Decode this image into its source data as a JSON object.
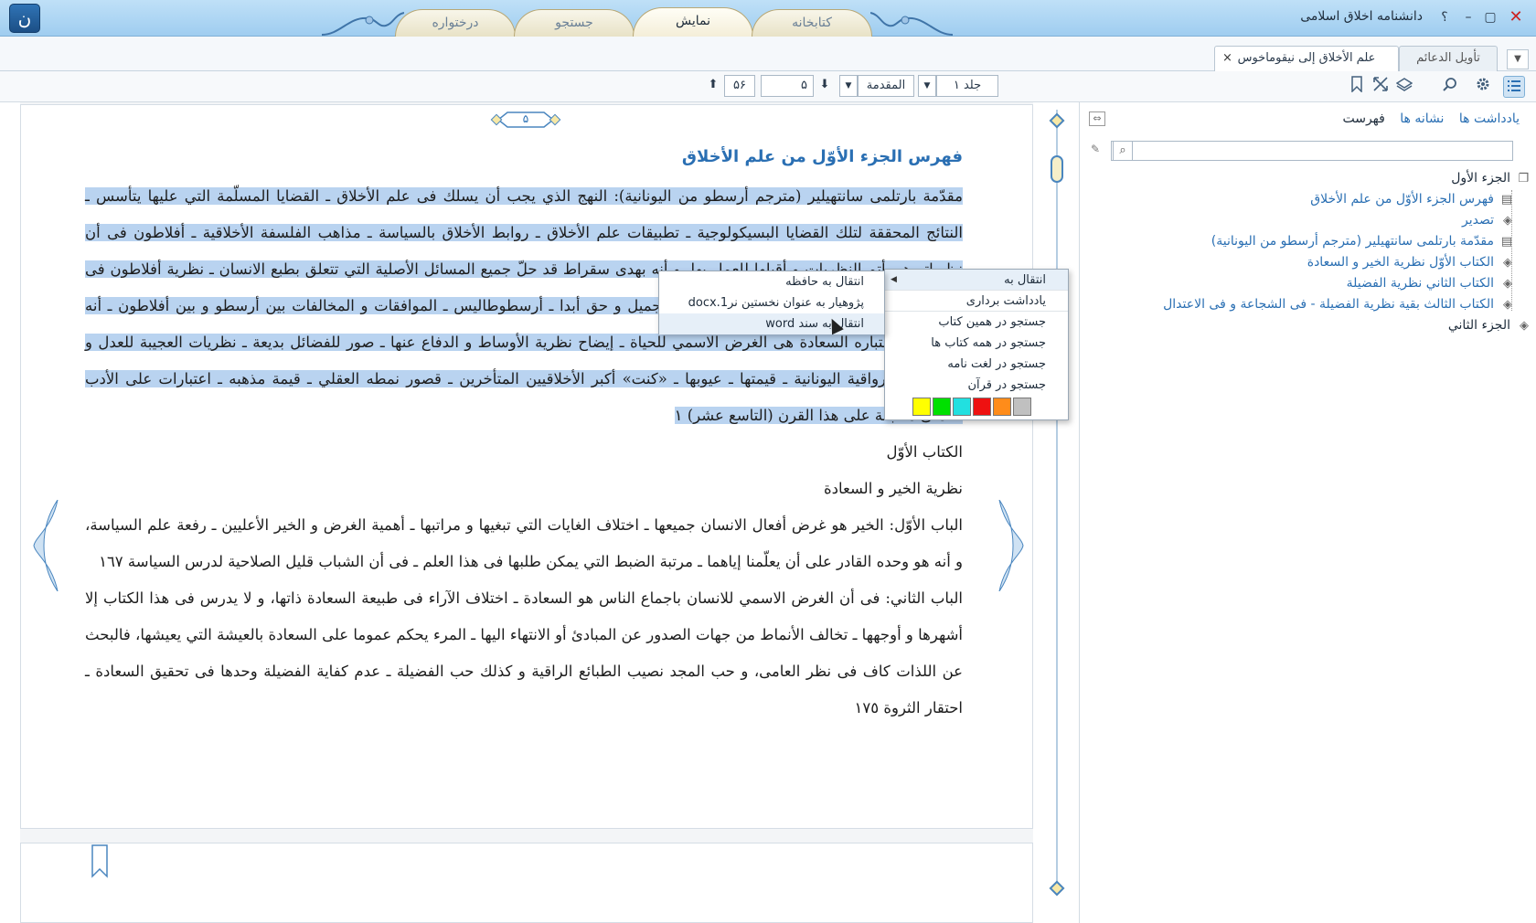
{
  "window": {
    "title": "دانشنامه اخلاق اسلامی",
    "help": "؟",
    "min": "–",
    "max": "▢",
    "close": "✕",
    "logo_glyph": "ن"
  },
  "main_tabs": [
    "کتابخانه",
    "نمایش",
    "جستجو",
    "درختواره"
  ],
  "book_tabs": {
    "tab1": "تأويل الدعائم",
    "tab2": "علم الأخلاق إلى نيقوماخوس",
    "close": "×",
    "dropdown": "▼"
  },
  "toolbar": {
    "volume": "جلد ١",
    "section": "المقدمة",
    "page": "۵",
    "total": "۵۶",
    "dropdown": "▼",
    "down": "⬇",
    "up": "⬆"
  },
  "side_panel": {
    "tabs": [
      "فهرست",
      "نشانه ها",
      "یادداشت ها"
    ],
    "tree": [
      {
        "label": "الجزء الأول",
        "level": 1,
        "icon": "book-icon"
      },
      {
        "label": "فهرس الجزء الأوّل من علم الأخلاق",
        "level": 2,
        "icon": "page-icon"
      },
      {
        "label": "تصدير",
        "level": 2,
        "icon": "layers-icon"
      },
      {
        "label": "مقدّمة بارتلمی سانتهيلير (مترجم أرسطو من اليونانية)",
        "level": 2,
        "icon": "page-icon"
      },
      {
        "label": "الكتاب الأوّل نظرية الخير و السعادة",
        "level": 2,
        "icon": "layers-icon"
      },
      {
        "label": "الكتاب الثاني نظرية الفضيلة",
        "level": 2,
        "icon": "layers-icon"
      },
      {
        "label": "الكتاب الثالث بقية نظرية الفضيلة - فی الشجاعة و فی الاعتدال",
        "level": 2,
        "icon": "layers-icon"
      },
      {
        "label": "الجزء الثاني",
        "level": 1,
        "icon": "layers-icon"
      }
    ]
  },
  "page": {
    "number": "۵",
    "heading": "فهرس الجزء الأوّل من علم الأخلاق",
    "selected_text": "مقدّمة بارتلمی سانتهيلير (مترجم أرسطو من اليونانية): النهج الذي يجب أن يسلك فی علم الأخلاق ـ القضايا المسلّمة التي عليها يتأسس ـ النتائج المحققة لتلك القضايا البسيكولوجية ـ تطبيقات علم الأخلاق ـ روابط الأخلاق بالسياسة ـ مذاهب الفلسفة الأخلاقية ـ أفلاطون فی أن نظرياته هی أتم النظريات و أقبلها للعمل بها، و أنه بهدى سقراط قد حلّ جميع المسائل الأصلية التي تتعلق بطبع الانسان ـ نظرية أفلاطون فی الخير معصومة من الخطأ ـ فی أن هذا المذهب جميل و حق أبدا ـ أرسطوطاليس ـ الموافقات و المخالفات بين أرسطو و بين أفلاطون ـ أنه انخدع فی اعتباره السعادة هی الغرض الاسمي للحياة ـ إيضاح نظرية الأوساط و الدفاع عنها ـ صور للفضائل بديعة ـ نظريات العجيبة للعدل و الصداقة ـ الرواقية اليونانية ـ قيمتها ـ عيوبها ـ «كنت» أكبر الأخلاقيين المتأخرين ـ قصور نمطه العقلي ـ قيمة مذهبه ـ اعتبارات على الأدب العملی مطبقة على هذا القرن (التاسع عشر) ١",
    "book1_title": "الكتاب الأوّل",
    "book1_subtitle": "نظرية الخير و السعادة",
    "chapter1": "الباب الأوّل: الخير هو غرض أفعال الانسان جميعها ـ اختلاف الغايات التي تبغيها و مراتبها ـ أهمية الغرض و الخير الأعليين ـ رفعة علم السياسة، و أنه هو وحده القادر على أن يعلّمنا إياهما ـ مرتبة الضبط التي يمكن طلبها فی هذا العلم ـ فی أن الشباب قليل الصلاحية لدرس السياسة ١٦٧",
    "chapter2": "الباب الثاني: فی أن الغرض الاسمي للانسان باجماع الناس هو السعادة ـ اختلاف الآراء فی طبيعة السعادة ذاتها، و لا يدرس فی هذا الكتاب إلا أشهرها و أوجهها ـ تخالف الأنماط من جهات الصدور عن المبادئ أو الانتهاء اليها ـ المرء يحكم عموما على السعادة بالعيشة التي يعيشها، فالبحث عن اللذات كاف فی نظر العامی، و حب المجد نصيب الطبائع الراقية و كذلك حب الفضيلة ـ عدم كفاية الفضيلة وحدها فی تحقيق السعادة ـ احتقار الثروة ١٧٥"
  },
  "context_menu": {
    "items": [
      "انتقال به",
      "یادداشت برداری",
      "جستجو در همین کتاب",
      "جستجو در همه کتاب ها",
      "جستجو در لغت نامه",
      "جستجو در قرآن"
    ],
    "arrow": "◀",
    "swatches": [
      "#ffff00",
      "#00e000",
      "#22e0e0",
      "#ee1111",
      "#ff8c1a",
      "#c0c0c0"
    ]
  },
  "submenu": {
    "items": [
      "انتقال به حافظه",
      "پژوهیار به عنوان نخستین نر1.docx",
      "انتقال به سند word"
    ]
  }
}
